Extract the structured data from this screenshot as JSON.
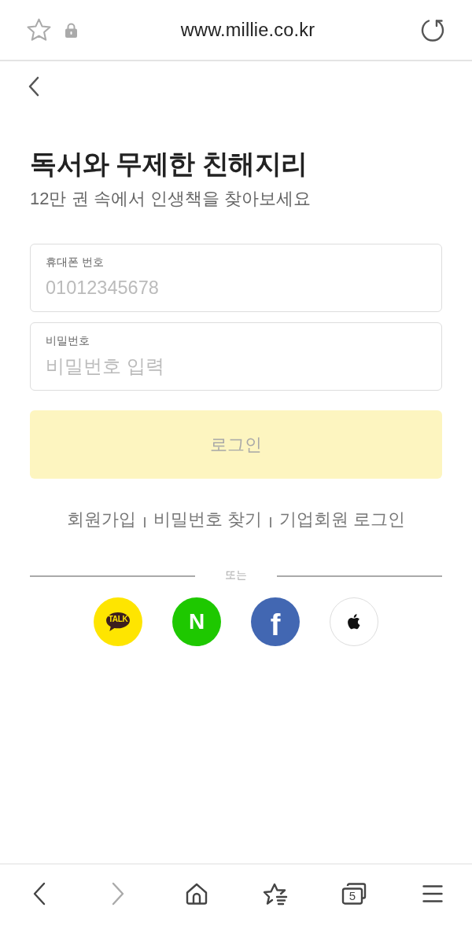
{
  "browser_bar": {
    "bookmarked": false,
    "secure": true,
    "url": "www.millie.co.kr"
  },
  "page": {
    "title": "독서와 무제한 친해지리",
    "subtitle": "12만 권 속에서 인생책을 찾아보세요"
  },
  "fields": [
    {
      "label": "휴대폰 번호",
      "placeholder": "01012345678"
    },
    {
      "label": "비밀번호",
      "placeholder": "비밀번호 입력"
    }
  ],
  "login_button": {
    "label": "로그인",
    "disabled": true
  },
  "links": [
    "회원가입",
    "비밀번호 찾기",
    "기업회원 로그인"
  ],
  "divider_label": "또는",
  "social_logins": [
    {
      "kind": "kakao",
      "color": "#fee500",
      "glyph": "TALK"
    },
    {
      "kind": "naver",
      "color": "#1ec800",
      "glyph": "N"
    },
    {
      "kind": "facebook",
      "color": "#4267b2",
      "glyph": "f"
    },
    {
      "kind": "apple",
      "color": "#ffffff"
    }
  ],
  "bottom_nav": [
    {
      "kind": "back",
      "disabled": false
    },
    {
      "kind": "forward",
      "disabled": true
    },
    {
      "kind": "home",
      "disabled": false
    },
    {
      "kind": "bookmarks",
      "disabled": false
    },
    {
      "kind": "tabs",
      "disabled": false,
      "count": "5"
    },
    {
      "kind": "menu",
      "disabled": false
    }
  ]
}
